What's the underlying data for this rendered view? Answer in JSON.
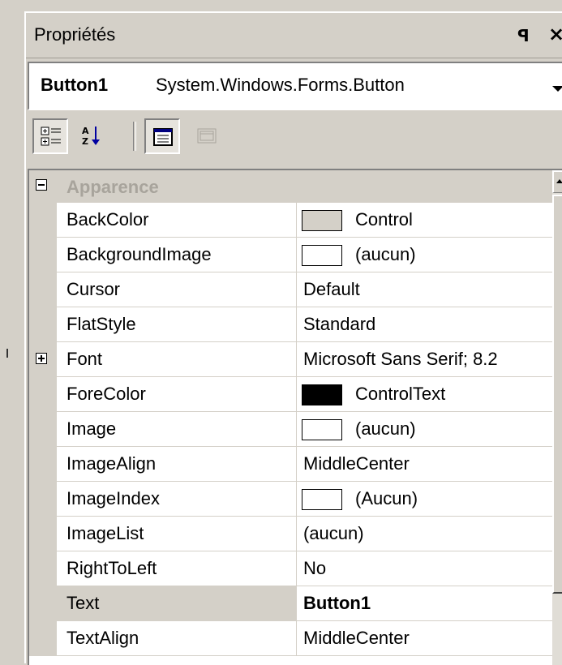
{
  "panel": {
    "title": "Propriétés"
  },
  "object_selector": {
    "name": "Button1",
    "type": "System.Windows.Forms.Button"
  },
  "toolbar": {
    "buttons": [
      {
        "name": "categorized-icon",
        "pressed": true
      },
      {
        "name": "alphabetical-icon",
        "pressed": false
      },
      {
        "name": "properties-icon",
        "pressed": true
      },
      {
        "name": "property-pages-icon",
        "pressed": false
      }
    ]
  },
  "grid": {
    "category": "Apparence",
    "rows": [
      {
        "name": "BackColor",
        "value": "Control",
        "swatch": "#d4d0c8"
      },
      {
        "name": "BackgroundImage",
        "value": "(aucun)",
        "swatch": "#ffffff"
      },
      {
        "name": "Cursor",
        "value": "Default"
      },
      {
        "name": "FlatStyle",
        "value": "Standard"
      },
      {
        "name": "Font",
        "value": "Microsoft Sans Serif; 8.2",
        "expandable": true
      },
      {
        "name": "ForeColor",
        "value": "ControlText",
        "swatch": "#000000"
      },
      {
        "name": "Image",
        "value": "(aucun)",
        "swatch": "#ffffff"
      },
      {
        "name": "ImageAlign",
        "value": "MiddleCenter"
      },
      {
        "name": "ImageIndex",
        "value": "(Aucun)",
        "swatch": "#ffffff"
      },
      {
        "name": "ImageList",
        "value": "(aucun)"
      },
      {
        "name": "RightToLeft",
        "value": "No"
      },
      {
        "name": "Text",
        "value": "Button1",
        "selected": true,
        "bold": true
      },
      {
        "name": "TextAlign",
        "value": "MiddleCenter"
      }
    ]
  }
}
